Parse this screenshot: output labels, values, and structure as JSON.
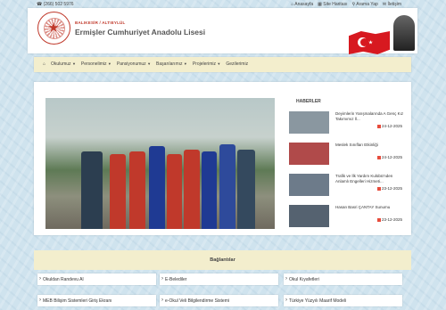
{
  "topbar": {
    "phone": "(266) 502 5976",
    "links": [
      "Anasayfa",
      "Site Haritası",
      "Arama Yap",
      "İletişim"
    ]
  },
  "header": {
    "subtitle": "BALIKESİR / ALTIEYLÜL",
    "school_name": "Ermişler Cumhuriyet Anadolu Lisesi"
  },
  "nav": {
    "items": [
      "Okulumuz",
      "Personelimiz",
      "Pansiyonumuz",
      "Başarılarımız",
      "Projelerimiz",
      "Gezilerimiz"
    ]
  },
  "news": {
    "heading": "HABERLER",
    "items": [
      {
        "title": "Deyimlerin Yarışmalarında A Genç Kız Takımımız İl...",
        "date": "24-12-2025"
      },
      {
        "title": "Meslek Sınıfları Etkinliği",
        "date": "24-12-2025"
      },
      {
        "title": "Trafik ve İlk Yardım Kulübü'nden Anlamlı Engelleri Hizmeti...",
        "date": "23-12-2025"
      },
      {
        "title": "Hasan Basri ÇANTAY Sunumu",
        "date": "23-12-2025"
      }
    ]
  },
  "links": {
    "heading": "Bağlantılar",
    "items": [
      "Okuldan Randevu Al",
      "E-Belediler",
      "Okul Kıyafetleri",
      "MEB Bilişim Sistemleri Giriş Ekranı",
      "e-Okul Veli Bilgilendirme Sistemi",
      "Türkiye Yüzyılı Maarif Modeli"
    ]
  },
  "icons": {
    "phone": "phone-icon",
    "home": "home-icon",
    "sitemap": "sitemap-icon",
    "search": "search-icon",
    "mail": "mail-icon"
  },
  "colors": {
    "accent": "#c0392b",
    "nav_bg": "#f3eecd",
    "flag": "#d71920"
  }
}
